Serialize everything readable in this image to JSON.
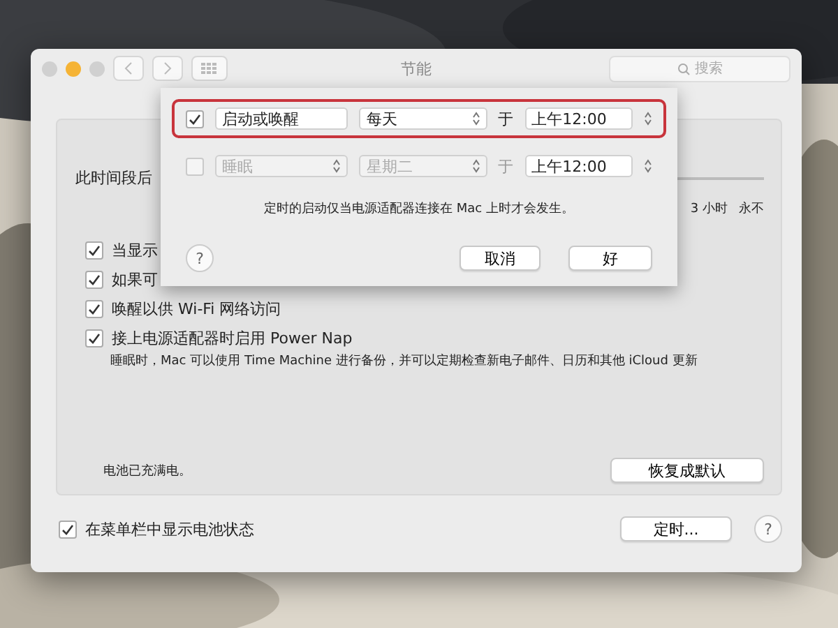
{
  "window": {
    "title": "节能",
    "search": {
      "placeholder": "搜索"
    }
  },
  "panel": {
    "sleep_label": "此时间段后",
    "slider_labels": [
      "3 小时",
      "永不"
    ],
    "options": [
      {
        "label": "当显示",
        "checked": true
      },
      {
        "label": "如果可",
        "checked": true
      },
      {
        "label": "唤醒以供 Wi-Fi 网络访问",
        "checked": true
      },
      {
        "label": "接上电源适配器时启用 Power Nap",
        "checked": true
      }
    ],
    "power_nap_note": "睡眠时，Mac 可以使用 Time Machine 进行备份，并可以定期检查新电子邮件、日历和其他 iCloud 更新",
    "battery_status": "电池已充满电。",
    "restore_button": "恢复成默认"
  },
  "footer": {
    "show_battery": {
      "label": "在菜单栏中显示电池状态",
      "checked": true
    },
    "schedule_button": "定时...",
    "help": "?"
  },
  "schedule_sheet": {
    "rows": [
      {
        "checked": true,
        "disabled": false,
        "highlighted": true,
        "action": "启动或唤醒",
        "day": "每天",
        "at": "于",
        "time": "上午12:00"
      },
      {
        "checked": false,
        "disabled": true,
        "highlighted": false,
        "action": "睡眠",
        "day": "星期二",
        "at": "于",
        "time": "上午12:00"
      }
    ],
    "note": "定时的启动仅当电源适配器连接在 Mac 上时才会发生。",
    "help": "?",
    "buttons": [
      "取消",
      "好"
    ]
  }
}
